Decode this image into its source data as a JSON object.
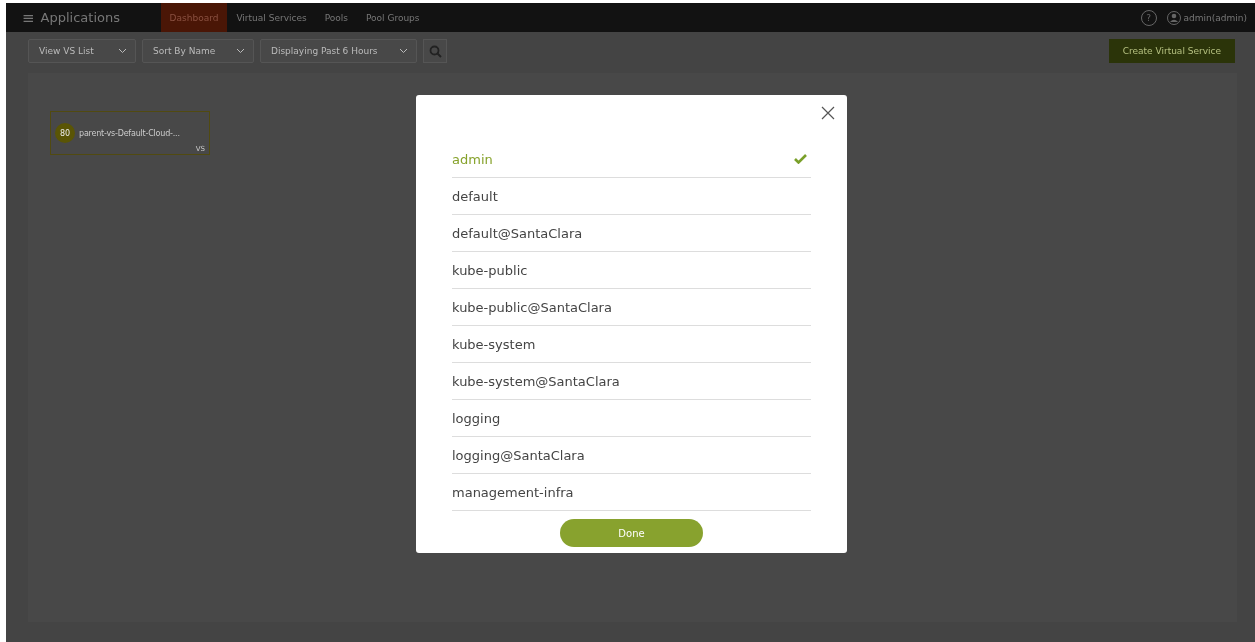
{
  "header": {
    "menu_icon": "≡",
    "title": "Applications",
    "tabs": [
      {
        "label": "Dashboard",
        "selected": true
      },
      {
        "label": "Virtual Services",
        "selected": false
      },
      {
        "label": "Pools",
        "selected": false
      },
      {
        "label": "Pool Groups",
        "selected": false
      }
    ],
    "help": "?",
    "user": "admin(admin)"
  },
  "toolbar": {
    "dropdowns": [
      "View VS List",
      "Sort By Name",
      "Displaying Past 6 Hours"
    ],
    "create_button": "Create Virtual Service"
  },
  "vs_cards": [
    {
      "score": "80",
      "name": "parent-vs-Default-Cloud-...",
      "type": "VS"
    }
  ],
  "tenant_dialog": {
    "items": [
      {
        "label": "admin",
        "selected": true
      },
      {
        "label": "default",
        "selected": false
      },
      {
        "label": "default@SantaClara",
        "selected": false
      },
      {
        "label": "kube-public",
        "selected": false
      },
      {
        "label": "kube-public@SantaClara",
        "selected": false
      },
      {
        "label": "kube-system",
        "selected": false
      },
      {
        "label": "kube-system@SantaClara",
        "selected": false
      },
      {
        "label": "logging",
        "selected": false
      },
      {
        "label": "logging@SantaClara",
        "selected": false
      },
      {
        "label": "management-infra",
        "selected": false
      }
    ],
    "done_button": "Done"
  }
}
